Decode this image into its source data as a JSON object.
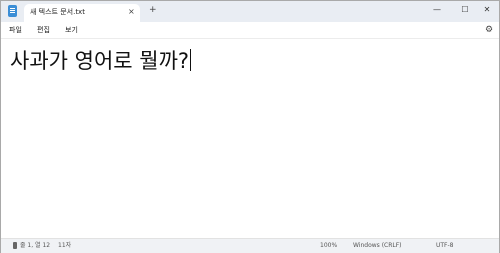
{
  "titlebar": {
    "tab_title": "새 텍스트 문서.txt",
    "tab_close": "×",
    "new_tab": "+",
    "minimize": "—",
    "maximize": "☐",
    "close": "✕"
  },
  "menu": {
    "items": [
      {
        "label": "파일"
      },
      {
        "label": "편집"
      },
      {
        "label": "보기"
      }
    ],
    "settings_icon": "⚙"
  },
  "editor": {
    "content": "사과가 영어로 뭘까?"
  },
  "status": {
    "position": "줄 1, 열 12",
    "char_count": "11자",
    "zoom": "100%",
    "line_ending": "Windows (CRLF)",
    "encoding": "UTF-8"
  },
  "colors": {
    "titlebar_bg": "#e9edf3",
    "statusbar_bg": "#f0f2f5",
    "accent": "#3b8ed6"
  }
}
